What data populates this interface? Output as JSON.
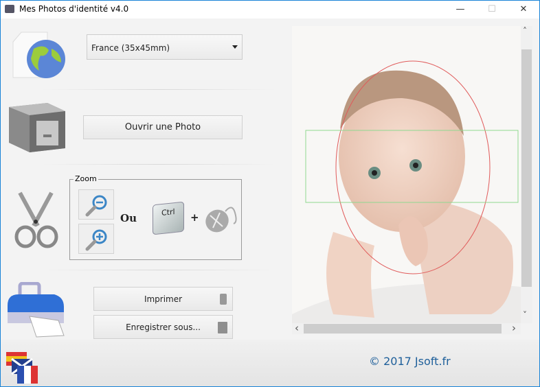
{
  "window": {
    "title": "Mes Photos d'identité v4.0",
    "minimize": "—",
    "maximize": "☐",
    "close": "✕"
  },
  "format": {
    "selected": "France (35x45mm)"
  },
  "open_label": "Ouvrir une Photo",
  "zoom": {
    "legend": "Zoom",
    "or_label": "Ou",
    "ctrl_key": "Ctrl",
    "plus": "+"
  },
  "print_label": "Imprimer",
  "save_label": "Enregistrer sous...",
  "footer": {
    "copyright": "© 2017 Jsoft.fr"
  },
  "scroll": {
    "up": "˄",
    "down": "˅",
    "left": "‹",
    "right": "›"
  }
}
